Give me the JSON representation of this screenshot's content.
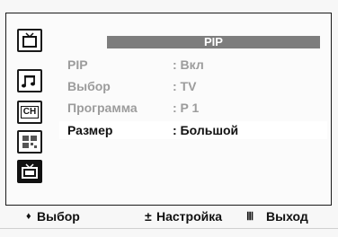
{
  "menu": {
    "title": "PIP",
    "rows": [
      {
        "label": "PIP",
        "value": ": Вкл",
        "state": "dim"
      },
      {
        "label": "Выбор",
        "value": ": TV",
        "state": "dim"
      },
      {
        "label": "Программа",
        "value": ": P 1",
        "state": "dim"
      },
      {
        "label": "Размер",
        "value": ": Большой",
        "state": "selected"
      }
    ]
  },
  "sidebar": {
    "icons": [
      {
        "name": "picture-icon"
      },
      {
        "name": "sound-icon"
      },
      {
        "name": "channel-icon",
        "label": "CH"
      },
      {
        "name": "setup-icon"
      },
      {
        "name": "input-icon",
        "active": true
      }
    ]
  },
  "footer": {
    "move_symbol": "♦",
    "move_label": "Выбор",
    "adjust_symbol": "±",
    "adjust_label": "Настройка",
    "exit_symbol": "Ⅲ",
    "exit_label": "Выход"
  },
  "colors": {
    "title_bar": "#7d7d7d",
    "dim_text": "#9c9c9c",
    "selected_bg": "#ffffff",
    "active_icon_bg": "#111111"
  }
}
